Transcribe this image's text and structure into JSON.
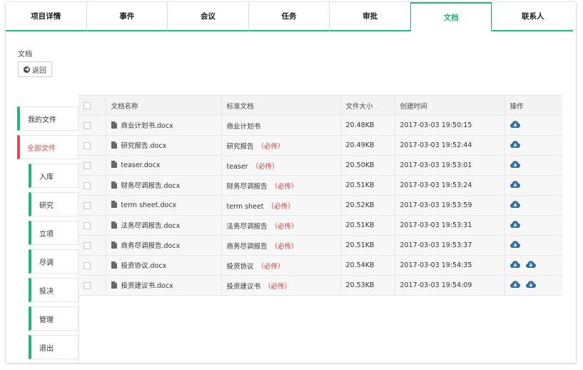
{
  "tabs": [
    "项目详情",
    "事件",
    "会议",
    "任务",
    "审批",
    "文档",
    "联系人"
  ],
  "active_tab": "文档",
  "section_title": "文档",
  "back_label": "返回",
  "menu": [
    {
      "label": "我的文件",
      "sub": false
    },
    {
      "label": "全部文件",
      "sub": false,
      "active": true
    },
    {
      "label": "入库",
      "sub": true
    },
    {
      "label": "研究",
      "sub": true
    },
    {
      "label": "立项",
      "sub": true
    },
    {
      "label": "尽调",
      "sub": true
    },
    {
      "label": "投决",
      "sub": true
    },
    {
      "label": "管理",
      "sub": true
    },
    {
      "label": "退出",
      "sub": true
    }
  ],
  "table": {
    "headers": [
      "文档名称",
      "标准文档",
      "文件大小",
      "创建时间",
      "操作"
    ],
    "rows": [
      {
        "name": "商业计划书.docx",
        "standard": "商业计划书",
        "required": "",
        "size": "20.48KB",
        "created": "2017-03-03 19:50:15",
        "actions": 1
      },
      {
        "name": "研究报告.docx",
        "standard": "研究报告",
        "required": "（必传）",
        "size": "20.49KB",
        "created": "2017-03-03 19:52:44",
        "actions": 1
      },
      {
        "name": "teaser.docx",
        "standard": "teaser",
        "required": "（必传）",
        "size": "20.50KB",
        "created": "2017-03-03 19:53:01",
        "actions": 1
      },
      {
        "name": "财务尽调报告.docx",
        "standard": "财务尽调报告",
        "required": "（必传）",
        "size": "20.51KB",
        "created": "2017-03-03 19:53:24",
        "actions": 1
      },
      {
        "name": "term sheet.docx",
        "standard": "term sheet",
        "required": "（必传）",
        "size": "20.52KB",
        "created": "2017-03-03 19:53:59",
        "actions": 1
      },
      {
        "name": "法务尽调报告.docx",
        "standard": "法务尽调报告",
        "required": "（必传）",
        "size": "20.51KB",
        "created": "2017-03-03 19:53:31",
        "actions": 1
      },
      {
        "name": "商务尽调报告.docx",
        "standard": "商务尽调报告",
        "required": "（必传）",
        "size": "20.51KB",
        "created": "2017-03-03 19:53:37",
        "actions": 1
      },
      {
        "name": "投资协议.docx",
        "standard": "投资协议",
        "required": "（必传）",
        "size": "20.54KB",
        "created": "2017-03-03 19:54:35",
        "actions": 2
      },
      {
        "name": "投资建议书.docx",
        "standard": "投资建议书",
        "required": "（必传）",
        "size": "20.53KB",
        "created": "2017-03-03 19:54:09",
        "actions": 2
      }
    ]
  },
  "colors": {
    "accent": "#2ab27b",
    "active_menu": "#e24a4a",
    "required_text": "#d33333",
    "cloud_icon": "#2f6fa7"
  },
  "icons": {
    "back": "arrow-left-circle-icon",
    "file": "file-icon",
    "action": "cloud-download-icon"
  }
}
